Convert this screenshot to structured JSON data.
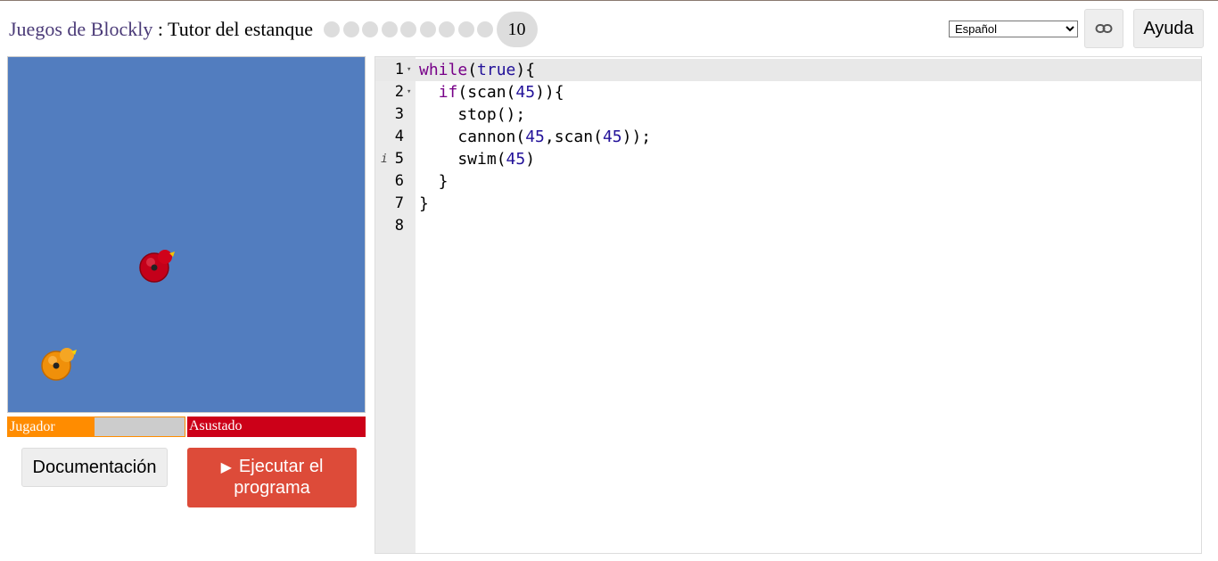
{
  "header": {
    "games_label": "Juegos de Blockly",
    "separator": " : ",
    "page_title": "Tutor del estanque",
    "level_count_dots": 9,
    "current_level": "10"
  },
  "language_select": {
    "selected": "Español"
  },
  "help_button": "Ayuda",
  "link_icon": "link-icon",
  "pond": {
    "background_color": "#527dbf",
    "avatars": [
      {
        "name": "red-duck",
        "color": "#d0021b"
      },
      {
        "name": "orange-duck",
        "color": "#f5a623"
      }
    ]
  },
  "health_bars": {
    "player": {
      "label": "Jugador",
      "health_fraction": 0.49,
      "color": "#ff8c00"
    },
    "opponent": {
      "label": "Asustado",
      "health_fraction": 1.0,
      "color": "#cc0018"
    }
  },
  "buttons": {
    "docs": "Documentación",
    "run_line1": "Ejecutar el",
    "run_line2": "programa"
  },
  "editor": {
    "line_numbers": [
      "1",
      "2",
      "3",
      "4",
      "5",
      "6",
      "7",
      "8"
    ],
    "lines": [
      "while(true){",
      "  if(scan(45)){",
      "    stop();",
      "    cannon(45,scan(45));",
      "    swim(45)",
      "  }",
      "}",
      ""
    ]
  }
}
